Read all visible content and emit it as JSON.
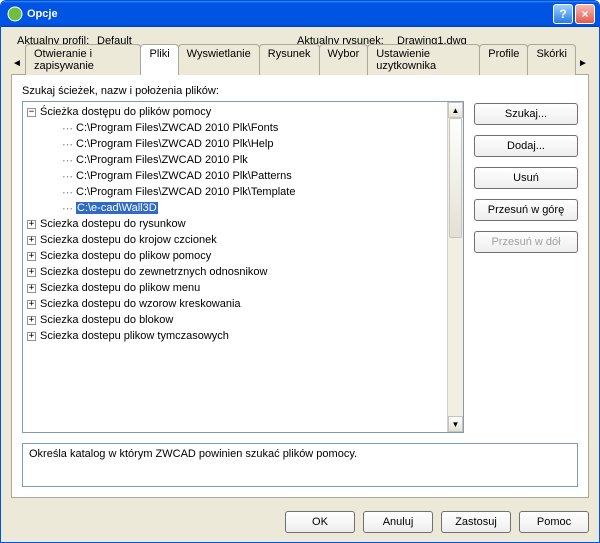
{
  "window": {
    "title": "Opcje"
  },
  "header": {
    "profile_label": "Aktualny profil:",
    "profile_value": "Default",
    "drawing_label": "Aktualny rysunek:",
    "drawing_value": "Drawing1.dwg"
  },
  "tabs": [
    {
      "label": "Otwieranie i zapisywanie"
    },
    {
      "label": "Pliki"
    },
    {
      "label": "Wyswietlanie"
    },
    {
      "label": "Rysunek"
    },
    {
      "label": "Wybor"
    },
    {
      "label": "Ustawienie uzytkownika"
    },
    {
      "label": "Profile"
    },
    {
      "label": "Skórki"
    }
  ],
  "active_tab_index": 1,
  "panel": {
    "instruction": "Szukaj ścieżek, nazw i położenia plików:",
    "tree": [
      {
        "label": "Ścieżka dostępu do plików pomocy",
        "expanded": true,
        "children": [
          "C:\\Program Files\\ZWCAD 2010 Plk\\Fonts",
          "C:\\Program Files\\ZWCAD 2010 Plk\\Help",
          "C:\\Program Files\\ZWCAD 2010 Plk",
          "C:\\Program Files\\ZWCAD 2010 Plk\\Patterns",
          "C:\\Program Files\\ZWCAD 2010 Plk\\Template",
          "C:\\e-cad\\Wall3D"
        ],
        "selected_child": 5
      },
      {
        "label": "Sciezka dostepu do rysunkow",
        "expanded": false
      },
      {
        "label": "Sciezka dostepu do krojow czcionek",
        "expanded": false
      },
      {
        "label": "Sciezka dostepu do plikow pomocy",
        "expanded": false
      },
      {
        "label": "Sciezka dostepu do zewnetrznych odnosnikow",
        "expanded": false
      },
      {
        "label": "Sciezka dostepu do plikow menu",
        "expanded": false
      },
      {
        "label": "Sciezka dostepu do wzorow kreskowania",
        "expanded": false
      },
      {
        "label": "Sciezka dostepu do blokow",
        "expanded": false
      },
      {
        "label": "Sciezka dostepu plikow tymczasowych",
        "expanded": false
      }
    ],
    "buttons": {
      "search": "Szukaj...",
      "add": "Dodaj...",
      "remove": "Usuń",
      "move_up": "Przesuń w górę",
      "move_down": "Przesuń w dół"
    },
    "hint": "Określa katalog w którym ZWCAD powinien szukać plików pomocy."
  },
  "footer": {
    "ok": "OK",
    "cancel": "Anuluj",
    "apply": "Zastosuj",
    "help": "Pomoc"
  }
}
